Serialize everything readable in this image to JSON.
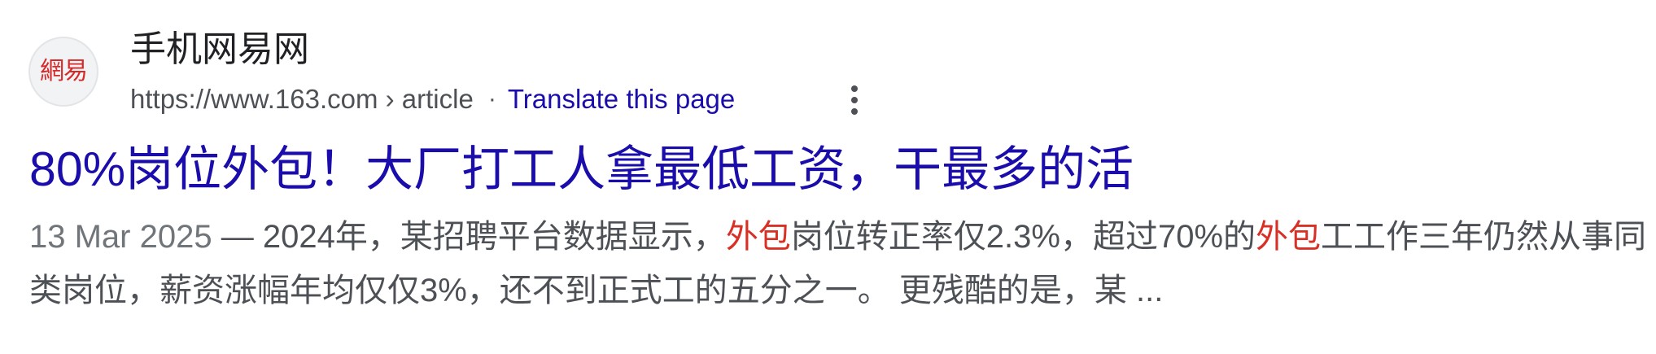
{
  "result": {
    "favicon_text": "網易",
    "favicon_icon": "netease-logo-icon",
    "site_name": "手机网易网",
    "url": "https://www.163.com › article",
    "separator": "·",
    "translate_label": "Translate this page",
    "more_icon": "more-vert-icon",
    "title": "80%岗位外包！大厂打工人拿最低工资，干最多的活",
    "snippet": {
      "date": "13 Mar 2025",
      "dash": " — ",
      "part1": "2024年，某招聘平台数据显示，",
      "highlight1": "外包",
      "part2": "岗位转正率仅2.3%，超过70%的",
      "highlight2": "外包",
      "part3": "工工作三年仍然从事同类岗位，薪资涨幅年均仅仅3%，还不到正式工的五分之一。 更残酷的是，某 ..."
    }
  },
  "colors": {
    "link": "#1a0dab",
    "text": "#4d5156",
    "highlight": "#d93025",
    "favicon_red": "#d62a2a"
  }
}
